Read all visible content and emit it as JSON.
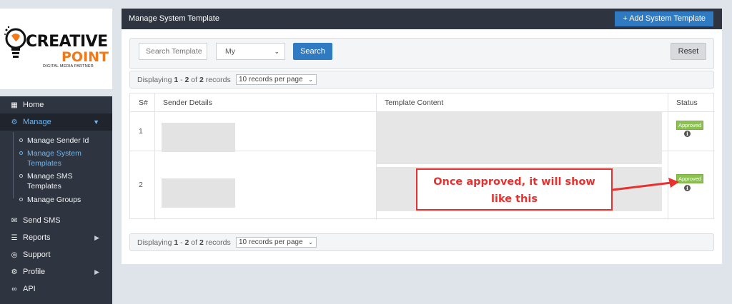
{
  "brand": {
    "line1": "CREATIVE",
    "line2": "POINT",
    "tagline": "DIGITAL MEDIA PARTNER",
    "accent": "#f07a1a"
  },
  "sidebar": {
    "items": [
      {
        "label": "Home",
        "icon": "home-icon"
      },
      {
        "label": "Manage",
        "icon": "cogs-icon"
      },
      {
        "label": "Send SMS",
        "icon": "envelope-icon"
      },
      {
        "label": "Reports",
        "icon": "list-icon"
      },
      {
        "label": "Support",
        "icon": "lifebuoy-icon"
      },
      {
        "label": "Profile",
        "icon": "gear-icon"
      },
      {
        "label": "API",
        "icon": "link-icon"
      }
    ],
    "manage_sub": [
      {
        "label": "Manage Sender Id"
      },
      {
        "label": "Manage System Templates"
      },
      {
        "label": "Manage SMS Templates"
      },
      {
        "label": "Manage Groups"
      }
    ]
  },
  "panel": {
    "title": "Manage System Template",
    "add_button": "+ Add System Template"
  },
  "filters": {
    "search_placeholder": "Search Template",
    "scope_value": "My",
    "search_button": "Search",
    "reset_button": "Reset"
  },
  "pager": {
    "prefix": "Displaying ",
    "from": "1",
    "sep1": " - ",
    "to": "2",
    "of": " of ",
    "total": "2",
    "suffix": " records",
    "per_page": "10 records per page"
  },
  "table": {
    "headers": [
      "S#",
      "Sender Details",
      "Template Content",
      "Status"
    ],
    "rows": [
      {
        "num": "1",
        "status": "Approved"
      },
      {
        "num": "2",
        "status": "Approved"
      }
    ]
  },
  "callout": {
    "line1": "Once approved, it will show",
    "line2": "like this",
    "color": "#e8302e"
  }
}
